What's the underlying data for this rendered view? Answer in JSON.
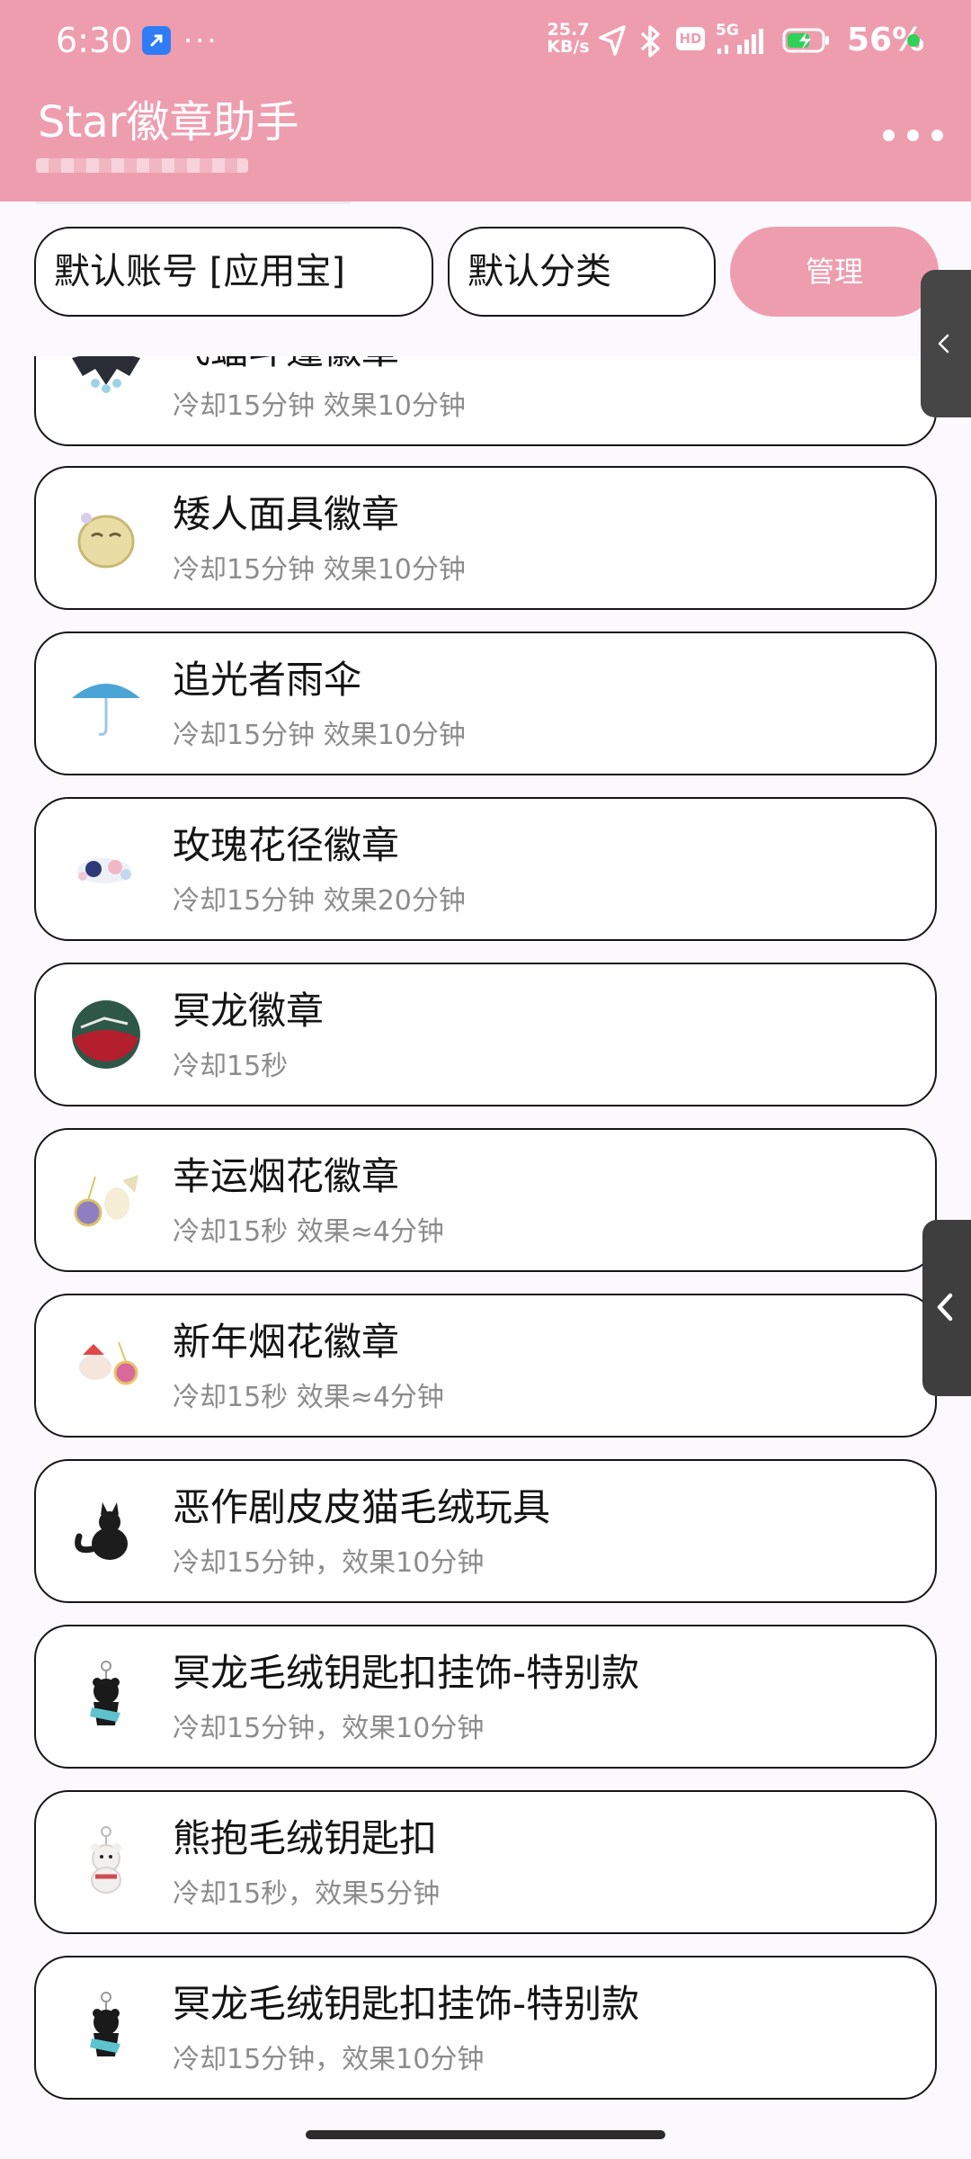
{
  "status_bar": {
    "time": "6:30",
    "more": "···",
    "net_speed_value": "25.7",
    "net_speed_unit": "KB/s",
    "hd_label": "HD",
    "network_label": "5G",
    "battery_percent": "56%",
    "icons": [
      "app-notification-icon",
      "location-arrow-icon",
      "bluetooth-icon",
      "hd-icon",
      "signal-icon",
      "battery-charging-icon"
    ],
    "colors": {
      "battery_fill": "#30d158",
      "dot": "#30d158"
    }
  },
  "app_bar": {
    "title": "Star徽章助手",
    "menu_icon": "more-dots-icon",
    "background": "#ee9daf"
  },
  "toolbar": {
    "account_select": "默认账号 [应用宝]",
    "category_select": "默认分类",
    "manage_button": "管理"
  },
  "list": {
    "items": [
      {
        "title": "飞蝠斗篷徽章",
        "desc": "冷却15分钟 效果10分钟",
        "icon": "bat-cape-badge-icon"
      },
      {
        "title": "矮人面具徽章",
        "desc": "冷却15分钟 效果10分钟",
        "icon": "dwarf-mask-badge-icon"
      },
      {
        "title": "追光者雨伞",
        "desc": "冷却15分钟 效果10分钟",
        "icon": "umbrella-icon"
      },
      {
        "title": "玫瑰花径徽章",
        "desc": "冷却15分钟 效果20分钟",
        "icon": "rose-path-badge-icon"
      },
      {
        "title": "冥龙徽章",
        "desc": "冷却15秒",
        "icon": "dark-dragon-badge-icon"
      },
      {
        "title": "幸运烟花徽章",
        "desc": "冷却15秒 效果≈4分钟",
        "icon": "lucky-firework-badge-icon"
      },
      {
        "title": "新年烟花徽章",
        "desc": "冷却15秒 效果≈4分钟",
        "icon": "new-year-firework-badge-icon"
      },
      {
        "title": "恶作剧皮皮猫毛绒玩具",
        "desc": "冷却15分钟，效果10分钟",
        "icon": "prank-cat-plush-icon"
      },
      {
        "title": "冥龙毛绒钥匙扣挂饰-特别款",
        "desc": "冷却15分钟，效果10分钟",
        "icon": "dragon-plush-keychain-icon"
      },
      {
        "title": "熊抱毛绒钥匙扣",
        "desc": "冷却15秒，效果5分钟",
        "icon": "bear-hug-plush-keychain-icon"
      },
      {
        "title": "冥龙毛绒钥匙扣挂饰-特别款",
        "desc": "冷却15分钟，效果10分钟",
        "icon": "dragon-plush-keychain-icon"
      }
    ]
  },
  "side_handles": {
    "icon": "chevron-left-icon"
  }
}
